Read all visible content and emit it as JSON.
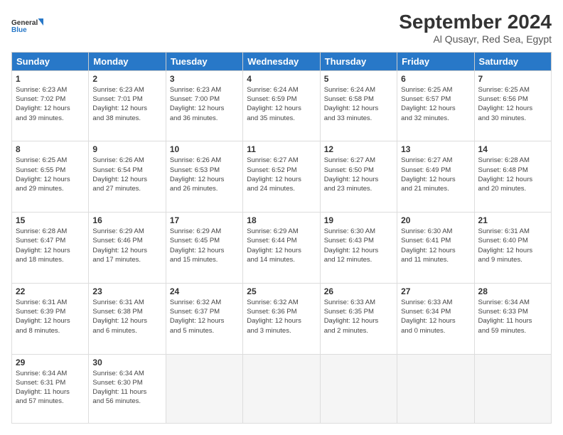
{
  "logo": {
    "line1": "General",
    "line2": "Blue"
  },
  "title": "September 2024",
  "location": "Al Qusayr, Red Sea, Egypt",
  "days_of_week": [
    "Sunday",
    "Monday",
    "Tuesday",
    "Wednesday",
    "Thursday",
    "Friday",
    "Saturday"
  ],
  "weeks": [
    [
      {
        "day": 1,
        "info": "Sunrise: 6:23 AM\nSunset: 7:02 PM\nDaylight: 12 hours\nand 39 minutes."
      },
      {
        "day": 2,
        "info": "Sunrise: 6:23 AM\nSunset: 7:01 PM\nDaylight: 12 hours\nand 38 minutes."
      },
      {
        "day": 3,
        "info": "Sunrise: 6:23 AM\nSunset: 7:00 PM\nDaylight: 12 hours\nand 36 minutes."
      },
      {
        "day": 4,
        "info": "Sunrise: 6:24 AM\nSunset: 6:59 PM\nDaylight: 12 hours\nand 35 minutes."
      },
      {
        "day": 5,
        "info": "Sunrise: 6:24 AM\nSunset: 6:58 PM\nDaylight: 12 hours\nand 33 minutes."
      },
      {
        "day": 6,
        "info": "Sunrise: 6:25 AM\nSunset: 6:57 PM\nDaylight: 12 hours\nand 32 minutes."
      },
      {
        "day": 7,
        "info": "Sunrise: 6:25 AM\nSunset: 6:56 PM\nDaylight: 12 hours\nand 30 minutes."
      }
    ],
    [
      {
        "day": 8,
        "info": "Sunrise: 6:25 AM\nSunset: 6:55 PM\nDaylight: 12 hours\nand 29 minutes."
      },
      {
        "day": 9,
        "info": "Sunrise: 6:26 AM\nSunset: 6:54 PM\nDaylight: 12 hours\nand 27 minutes."
      },
      {
        "day": 10,
        "info": "Sunrise: 6:26 AM\nSunset: 6:53 PM\nDaylight: 12 hours\nand 26 minutes."
      },
      {
        "day": 11,
        "info": "Sunrise: 6:27 AM\nSunset: 6:52 PM\nDaylight: 12 hours\nand 24 minutes."
      },
      {
        "day": 12,
        "info": "Sunrise: 6:27 AM\nSunset: 6:50 PM\nDaylight: 12 hours\nand 23 minutes."
      },
      {
        "day": 13,
        "info": "Sunrise: 6:27 AM\nSunset: 6:49 PM\nDaylight: 12 hours\nand 21 minutes."
      },
      {
        "day": 14,
        "info": "Sunrise: 6:28 AM\nSunset: 6:48 PM\nDaylight: 12 hours\nand 20 minutes."
      }
    ],
    [
      {
        "day": 15,
        "info": "Sunrise: 6:28 AM\nSunset: 6:47 PM\nDaylight: 12 hours\nand 18 minutes."
      },
      {
        "day": 16,
        "info": "Sunrise: 6:29 AM\nSunset: 6:46 PM\nDaylight: 12 hours\nand 17 minutes."
      },
      {
        "day": 17,
        "info": "Sunrise: 6:29 AM\nSunset: 6:45 PM\nDaylight: 12 hours\nand 15 minutes."
      },
      {
        "day": 18,
        "info": "Sunrise: 6:29 AM\nSunset: 6:44 PM\nDaylight: 12 hours\nand 14 minutes."
      },
      {
        "day": 19,
        "info": "Sunrise: 6:30 AM\nSunset: 6:43 PM\nDaylight: 12 hours\nand 12 minutes."
      },
      {
        "day": 20,
        "info": "Sunrise: 6:30 AM\nSunset: 6:41 PM\nDaylight: 12 hours\nand 11 minutes."
      },
      {
        "day": 21,
        "info": "Sunrise: 6:31 AM\nSunset: 6:40 PM\nDaylight: 12 hours\nand 9 minutes."
      }
    ],
    [
      {
        "day": 22,
        "info": "Sunrise: 6:31 AM\nSunset: 6:39 PM\nDaylight: 12 hours\nand 8 minutes."
      },
      {
        "day": 23,
        "info": "Sunrise: 6:31 AM\nSunset: 6:38 PM\nDaylight: 12 hours\nand 6 minutes."
      },
      {
        "day": 24,
        "info": "Sunrise: 6:32 AM\nSunset: 6:37 PM\nDaylight: 12 hours\nand 5 minutes."
      },
      {
        "day": 25,
        "info": "Sunrise: 6:32 AM\nSunset: 6:36 PM\nDaylight: 12 hours\nand 3 minutes."
      },
      {
        "day": 26,
        "info": "Sunrise: 6:33 AM\nSunset: 6:35 PM\nDaylight: 12 hours\nand 2 minutes."
      },
      {
        "day": 27,
        "info": "Sunrise: 6:33 AM\nSunset: 6:34 PM\nDaylight: 12 hours\nand 0 minutes."
      },
      {
        "day": 28,
        "info": "Sunrise: 6:34 AM\nSunset: 6:33 PM\nDaylight: 11 hours\nand 59 minutes."
      }
    ],
    [
      {
        "day": 29,
        "info": "Sunrise: 6:34 AM\nSunset: 6:31 PM\nDaylight: 11 hours\nand 57 minutes."
      },
      {
        "day": 30,
        "info": "Sunrise: 6:34 AM\nSunset: 6:30 PM\nDaylight: 11 hours\nand 56 minutes."
      },
      null,
      null,
      null,
      null,
      null
    ]
  ]
}
